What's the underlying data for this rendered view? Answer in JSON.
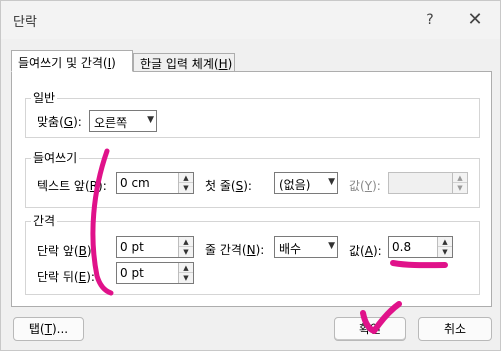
{
  "window": {
    "title": "단락",
    "help_glyph": "?",
    "close_glyph": "✕"
  },
  "tabs": [
    {
      "label": "들여쓰기 및 간격(I)",
      "text": "들여쓰기 및 간격(",
      "key": "I",
      "end": ")"
    },
    {
      "label": "한글 입력 체계(H)",
      "text": "한글 입력 체계(",
      "key": "H",
      "end": ")"
    }
  ],
  "general": {
    "heading": "일반",
    "align_label": "맞춤(G):",
    "align_text": "맞춤(",
    "align_key": "G",
    "align_end": "):",
    "align_value": "오른쪽"
  },
  "indent": {
    "heading": "들여쓰기",
    "before_text_label": "텍스트 앞(R):",
    "before_text": "텍스트 앞(",
    "before_key": "R",
    "before_end": "):",
    "before_text_value": "0 cm",
    "first_line_label": "첫 줄(S):",
    "first_text": "첫 줄(",
    "first_key": "S",
    "first_end": "):",
    "first_line_value": "(없음)",
    "by_label": "값(Y):",
    "by_text": "값(",
    "by_key": "Y",
    "by_end": "):",
    "by_value": ""
  },
  "spacing": {
    "heading": "간격",
    "before_label": "단락 앞(B):",
    "before_text": "단락 앞(",
    "before_key": "B",
    "before_end": "):",
    "before_value": "0 pt",
    "after_label": "단락 뒤(E):",
    "after_text": "단락 뒤(",
    "after_key": "E",
    "after_end": "):",
    "after_value": "0 pt",
    "line_label": "줄 간격(N):",
    "line_text": "줄 간격(",
    "line_key": "N",
    "line_end": "):",
    "line_value": "배수",
    "at_label": "값(A):",
    "at_text": "값(",
    "at_key": "A",
    "at_end": "):",
    "at_value": "0.8"
  },
  "footer": {
    "tabs_button": "탭(T)...",
    "tabs_text": "탭(",
    "tabs_key": "T",
    "tabs_end": ")...",
    "ok_button": "확인",
    "cancel_button": "취소"
  },
  "colors": {
    "annotation_ink": "#e0128a",
    "dialog_bg": "#f0f0f0",
    "panel_bg": "#ffffff"
  },
  "icons": {
    "dropdown": "chevron-down-icon",
    "spin_up": "spin-up-icon",
    "spin_down": "spin-down-icon"
  }
}
